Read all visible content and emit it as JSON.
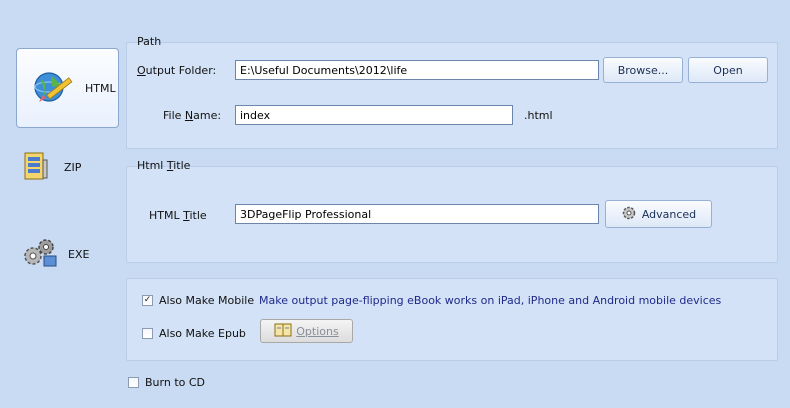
{
  "sidebar": {
    "items": [
      {
        "label": "HTML",
        "icon": "globe-pencil-icon",
        "active": true
      },
      {
        "label": "ZIP",
        "icon": "archive-zip-icon",
        "active": false
      },
      {
        "label": "EXE",
        "icon": "gears-icon",
        "active": false
      }
    ]
  },
  "path_group": {
    "title": "Path",
    "output_folder_label_pre": "",
    "output_folder_label_mn": "O",
    "output_folder_label_post": "utput Folder:",
    "output_folder_value": "E:\\Useful Documents\\2012\\life",
    "browse_label": "Browse...",
    "open_label": "Open",
    "file_name_label_pre": "File ",
    "file_name_label_mn": "N",
    "file_name_label_post": "ame:",
    "file_name_value": "index",
    "extension": ".html"
  },
  "title_group": {
    "title_pre": "Html ",
    "title_mn": "T",
    "title_post": "itle",
    "html_title_label_pre": "HTML ",
    "html_title_label_mn": "T",
    "html_title_label_post": "itle",
    "html_title_value": "3DPageFlip Professional",
    "advanced_label": "Advanced"
  },
  "options_group": {
    "mobile_label": "Also Make Mobile",
    "mobile_checked": true,
    "mobile_note": "Make output page-flipping eBook works on iPad, iPhone and Android mobile devices",
    "epub_label": "Also Make Epub",
    "epub_checked": false,
    "options_label": "Options"
  },
  "burn": {
    "label": "Burn to CD",
    "checked": false
  },
  "colors": {
    "background": "#c9daf3",
    "note_text": "#1f2a8a"
  }
}
